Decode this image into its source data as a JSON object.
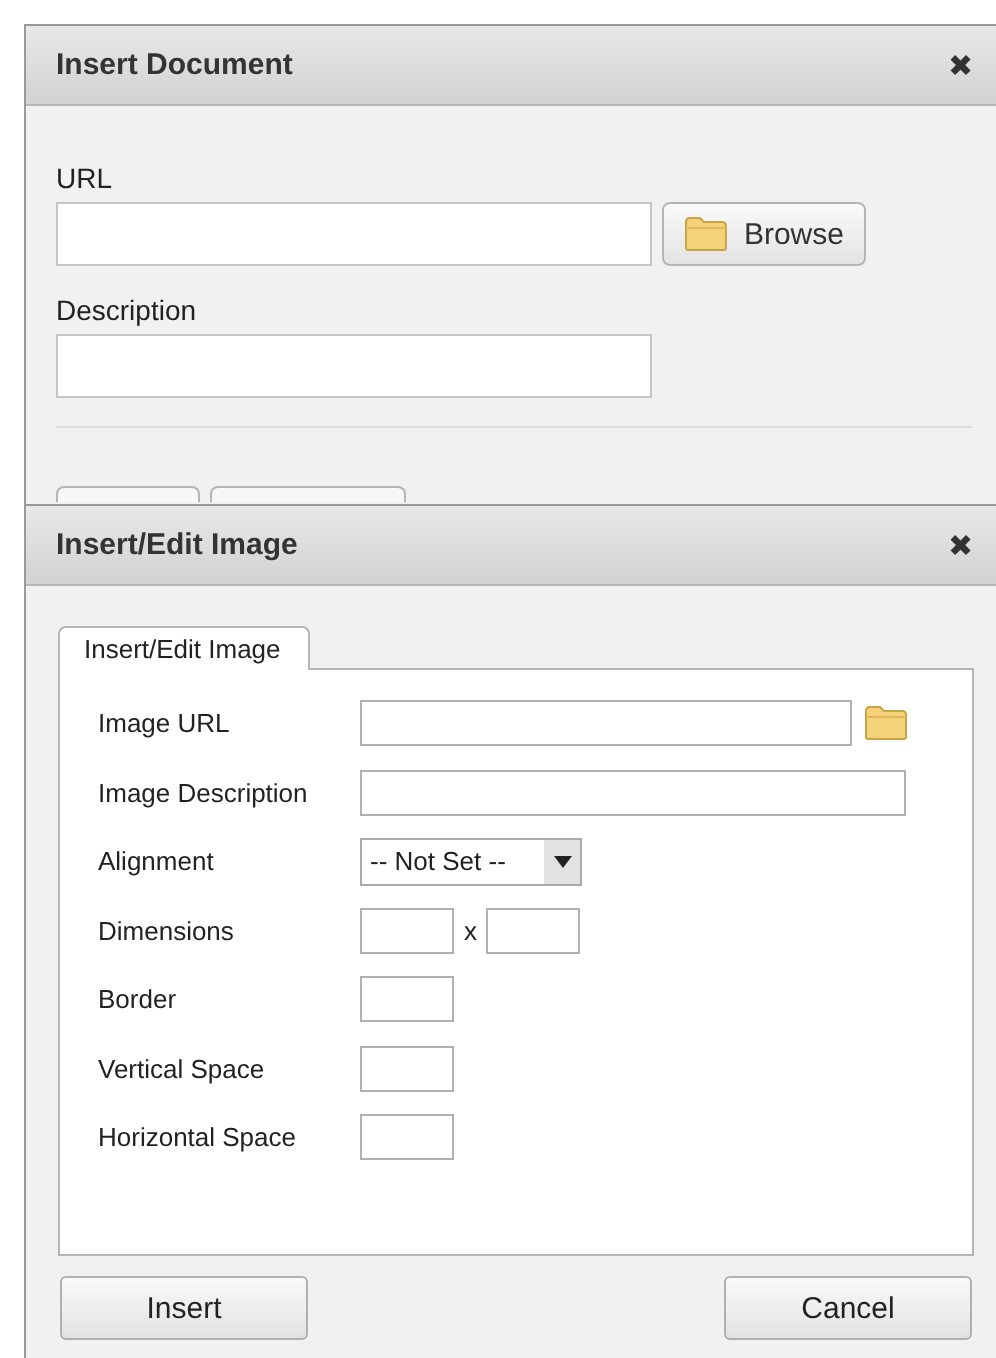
{
  "document_dialog": {
    "title": "Insert Document",
    "close": "✖",
    "fields": [
      {
        "label": "URL",
        "kind": "browse",
        "button": "Browse"
      },
      {
        "label": "Description",
        "kind": "text"
      }
    ]
  },
  "image_dialog": {
    "title": "Insert/Edit Image",
    "close": "✖",
    "tabs": [
      {
        "label": "Insert/Edit Image",
        "selected": true
      }
    ],
    "fields": [
      {
        "label": "Image URL",
        "kind": "browse"
      },
      {
        "label": "Image Description",
        "kind": "wide"
      },
      {
        "label": "Alignment",
        "kind": "select",
        "value": "-- Not Set --"
      },
      {
        "label": "Dimensions",
        "kind": "pair",
        "separator": "x"
      },
      {
        "label": "Border",
        "kind": "small"
      },
      {
        "label": "Vertical Space",
        "kind": "small"
      },
      {
        "label": "Horizontal Space",
        "kind": "small"
      }
    ],
    "buttons": [
      "Insert",
      "Cancel"
    ]
  }
}
